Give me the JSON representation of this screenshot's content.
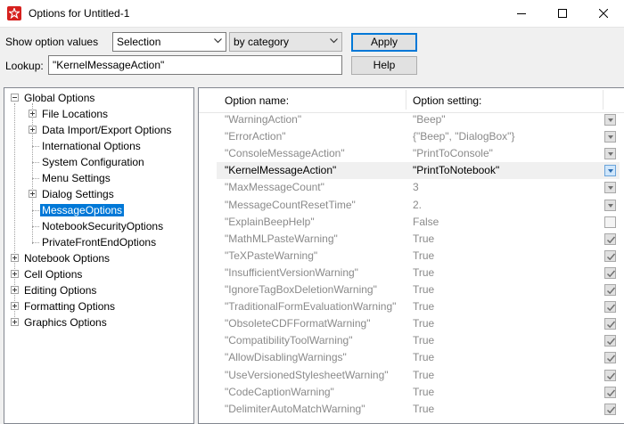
{
  "window": {
    "title": "Options for Untitled-1"
  },
  "toolbar": {
    "show_label": "Show option values",
    "scope_value": "Selection",
    "group_value": "by category",
    "apply_label": "Apply",
    "lookup_label": "Lookup:",
    "lookup_value": "\"KernelMessageAction\"",
    "help_label": "Help"
  },
  "tree": [
    {
      "label": "Global Options",
      "level": 0,
      "expander": "minus"
    },
    {
      "label": "File Locations",
      "level": 1,
      "expander": "plus"
    },
    {
      "label": "Data Import/Export Options",
      "level": 1,
      "expander": "plus"
    },
    {
      "label": "International Options",
      "level": 1,
      "expander": "none"
    },
    {
      "label": "System Configuration",
      "level": 1,
      "expander": "none"
    },
    {
      "label": "Menu Settings",
      "level": 1,
      "expander": "none"
    },
    {
      "label": "Dialog Settings",
      "level": 1,
      "expander": "plus"
    },
    {
      "label": "MessageOptions",
      "level": 1,
      "expander": "none",
      "selected": true
    },
    {
      "label": "NotebookSecurityOptions",
      "level": 1,
      "expander": "none"
    },
    {
      "label": "PrivateFrontEndOptions",
      "level": 1,
      "expander": "none"
    },
    {
      "label": "Notebook Options",
      "level": 0,
      "expander": "plus"
    },
    {
      "label": "Cell Options",
      "level": 0,
      "expander": "plus"
    },
    {
      "label": "Editing Options",
      "level": 0,
      "expander": "plus"
    },
    {
      "label": "Formatting Options",
      "level": 0,
      "expander": "plus"
    },
    {
      "label": "Graphics Options",
      "level": 0,
      "expander": "plus"
    }
  ],
  "options_table": {
    "col_name": "Option name:",
    "col_setting": "Option setting:",
    "rows": [
      {
        "name": "\"WarningAction\"",
        "setting": "\"Beep\"",
        "control": "dropdown"
      },
      {
        "name": "\"ErrorAction\"",
        "setting": "{\"Beep\", \"DialogBox\"}",
        "control": "dropdown"
      },
      {
        "name": "\"ConsoleMessageAction\"",
        "setting": "\"PrintToConsole\"",
        "control": "dropdown"
      },
      {
        "name": "\"KernelMessageAction\"",
        "setting": "\"PrintToNotebook\"",
        "control": "dropdown",
        "current": true
      },
      {
        "name": "\"MaxMessageCount\"",
        "setting": "3",
        "control": "dropdown"
      },
      {
        "name": "\"MessageCountResetTime\"",
        "setting": "2.",
        "control": "dropdown"
      },
      {
        "name": "\"ExplainBeepHelp\"",
        "setting": "False",
        "control": "checkbox-off"
      },
      {
        "name": "\"MathMLPasteWarning\"",
        "setting": "True",
        "control": "checkbox-on"
      },
      {
        "name": "\"TeXPasteWarning\"",
        "setting": "True",
        "control": "checkbox-on"
      },
      {
        "name": "\"InsufficientVersionWarning\"",
        "setting": "True",
        "control": "checkbox-on"
      },
      {
        "name": "\"IgnoreTagBoxDeletionWarning\"",
        "setting": "True",
        "control": "checkbox-on"
      },
      {
        "name": "\"TraditionalFormEvaluationWarning\"",
        "setting": "True",
        "control": "checkbox-on"
      },
      {
        "name": "\"ObsoleteCDFFormatWarning\"",
        "setting": "True",
        "control": "checkbox-on"
      },
      {
        "name": "\"CompatibilityToolWarning\"",
        "setting": "True",
        "control": "checkbox-on"
      },
      {
        "name": "\"AllowDisablingWarnings\"",
        "setting": "True",
        "control": "checkbox-on"
      },
      {
        "name": "\"UseVersionedStylesheetWarning\"",
        "setting": "True",
        "control": "checkbox-on"
      },
      {
        "name": "\"CodeCaptionWarning\"",
        "setting": "True",
        "control": "checkbox-on"
      },
      {
        "name": "\"DelimiterAutoMatchWarning\"",
        "setting": "True",
        "control": "checkbox-on"
      }
    ]
  }
}
